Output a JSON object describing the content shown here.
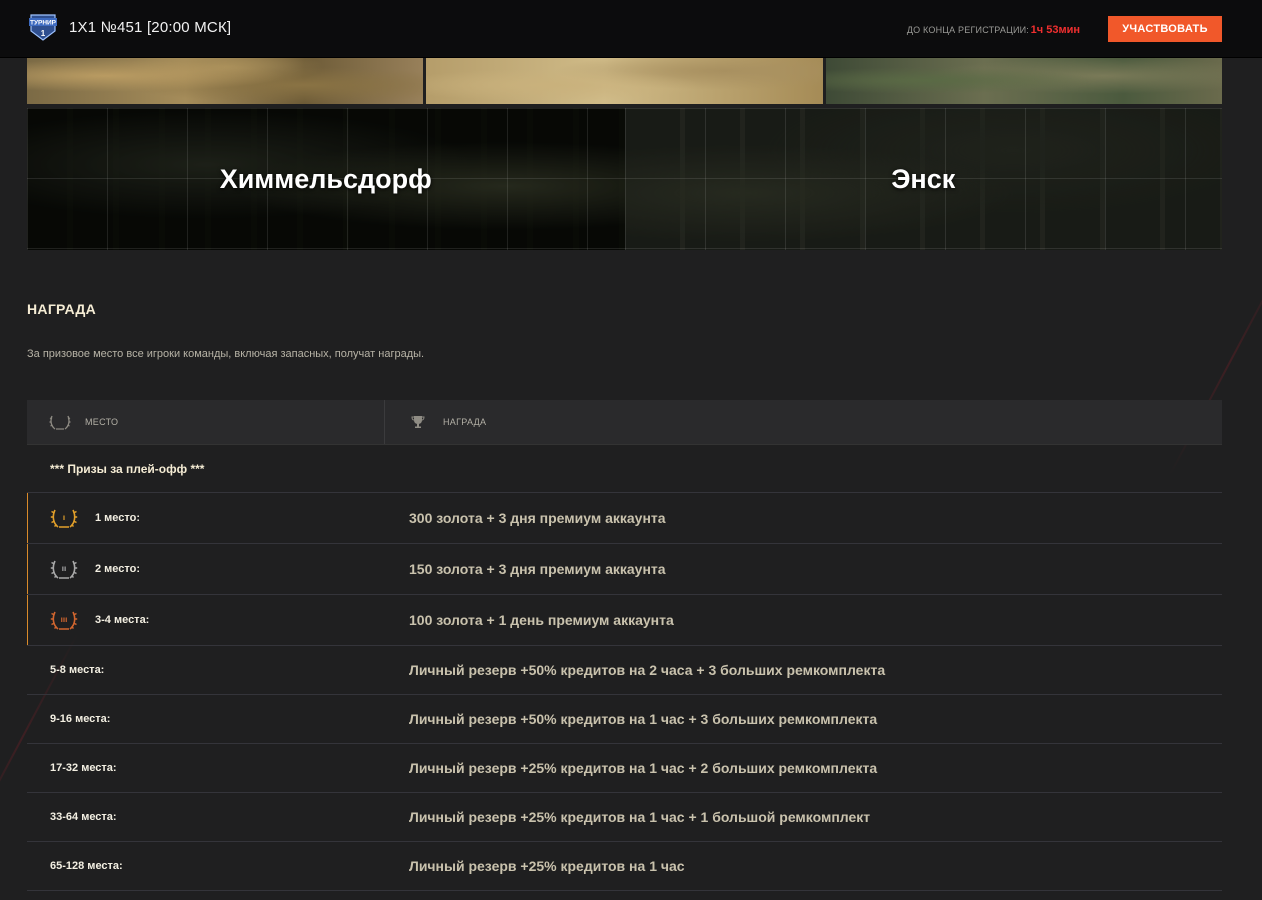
{
  "header": {
    "logo_text": "ТУРНИР",
    "logo_number": "1",
    "title": "1Х1 №451 [20:00 МСК]",
    "registration_label": "ДО КОНЦА РЕГИСТРАЦИИ:",
    "registration_time": "1ч 53мин",
    "join_button": "УЧАСТВОВАТЬ"
  },
  "maps": {
    "top_strip": [
      "",
      "",
      ""
    ],
    "named": [
      {
        "name": "Химмельсдорф"
      },
      {
        "name": "Энск"
      }
    ]
  },
  "reward": {
    "title": "НАГРАДА",
    "description": "За призовое место все игроки команды, включая запасных, получат награды.",
    "columns": {
      "place": "МЕСТО",
      "reward": "НАГРАДА"
    },
    "group_label": "*** Призы за плей-офф ***",
    "medal_rows": [
      {
        "place": "1 место:",
        "reward": "300 золота + 3 дня премиум аккаунта",
        "medal": "gold",
        "numeral": "I"
      },
      {
        "place": "2 место:",
        "reward": "150 золота + 3 дня премиум аккаунта",
        "medal": "silver",
        "numeral": "II"
      },
      {
        "place": "3-4 места:",
        "reward": "100 золота + 1 день премиум аккаунта",
        "medal": "bronze",
        "numeral": "III"
      }
    ],
    "plain_rows": [
      {
        "place": "5-8 места:",
        "reward": "Личный резерв +50% кредитов на 2 часа + 3 больших ремкомплекта"
      },
      {
        "place": "9-16 места:",
        "reward": "Личный резерв +50% кредитов на 1 час + 3 больших ремкомплекта"
      },
      {
        "place": "17-32 места:",
        "reward": "Личный резерв +25% кредитов на 1 час + 2 больших ремкомплекта"
      },
      {
        "place": "33-64 места:",
        "reward": "Личный резерв +25% кредитов на 1 час + 1 большой ремкомплект"
      },
      {
        "place": "65-128 места:",
        "reward": "Личный резерв +25% кредитов на 1 час"
      }
    ]
  },
  "colors": {
    "accent": "#f1582a",
    "timer": "#f02f2f",
    "gold": "#e3a02a",
    "silver": "#a9a9a9",
    "bronze": "#d2662f"
  }
}
